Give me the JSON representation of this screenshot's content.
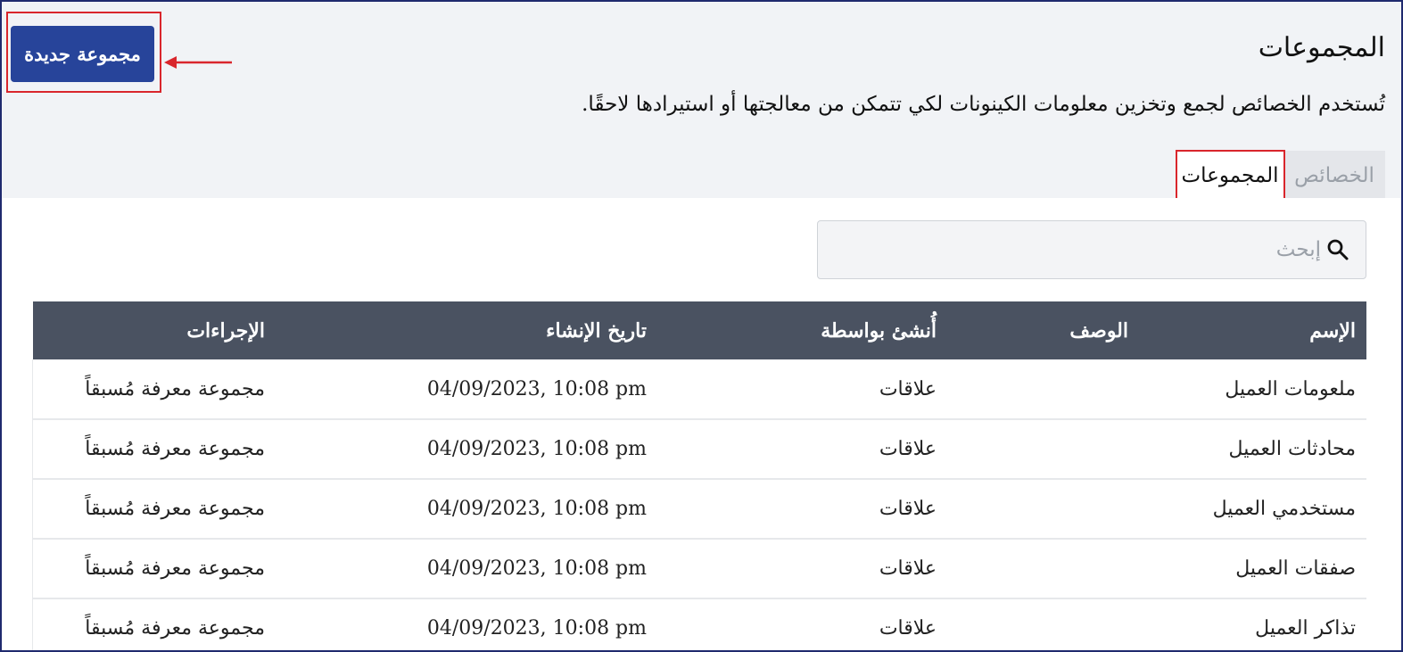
{
  "header": {
    "title": "المجموعات",
    "description": "تُستخدم الخصائص لجمع وتخزين معلومات الكينونات لكي تتمكن من معالجتها أو استيرادها لاحقًا.",
    "new_group_button": "مجموعة جديدة"
  },
  "tabs": [
    {
      "label": "الخصائص",
      "active": false
    },
    {
      "label": "المجموعات",
      "active": true
    }
  ],
  "search": {
    "placeholder": "إبحث",
    "value": ""
  },
  "table": {
    "columns": [
      "الإسم",
      "الوصف",
      "أُنشئ بواسطة",
      "تاريخ الإنشاء",
      "الإجراءات"
    ],
    "rows": [
      {
        "name": "ملعومات العميل",
        "description": "",
        "created_by": "علاقات",
        "created_at": "04/09/2023, 10:08 pm",
        "actions": "مجموعة معرفة مُسبقاً"
      },
      {
        "name": "محادثات العميل",
        "description": "",
        "created_by": "علاقات",
        "created_at": "04/09/2023, 10:08 pm",
        "actions": "مجموعة معرفة مُسبقاً"
      },
      {
        "name": "مستخدمي العميل",
        "description": "",
        "created_by": "علاقات",
        "created_at": "04/09/2023, 10:08 pm",
        "actions": "مجموعة معرفة مُسبقاً"
      },
      {
        "name": "صفقات العميل",
        "description": "",
        "created_by": "علاقات",
        "created_at": "04/09/2023, 10:08 pm",
        "actions": "مجموعة معرفة مُسبقاً"
      },
      {
        "name": "تذاكر العميل",
        "description": "",
        "created_by": "علاقات",
        "created_at": "04/09/2023, 10:08 pm",
        "actions": "مجموعة معرفة مُسبقاً"
      }
    ]
  },
  "colors": {
    "primary_button": "#27449a",
    "table_header": "#4a5261",
    "highlight": "#d9262c",
    "frame": "#1f2a6e"
  }
}
